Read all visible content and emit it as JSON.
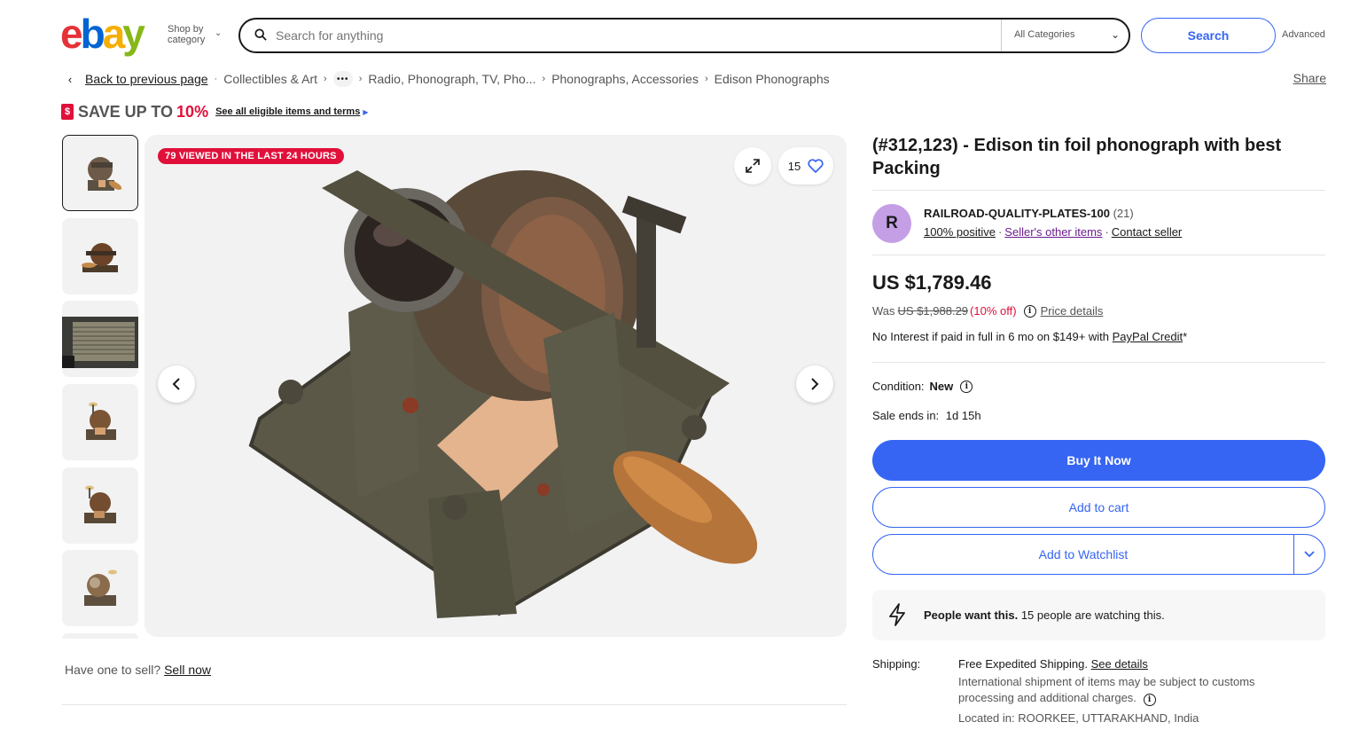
{
  "header": {
    "logo_letters": [
      "e",
      "b",
      "a",
      "y"
    ],
    "shop_by_line1": "Shop by",
    "shop_by_line2": "category",
    "search_placeholder": "Search for anything",
    "category_select": "All Categories",
    "search_button": "Search",
    "advanced_link": "Advanced"
  },
  "breadcrumb": {
    "back": "Back to previous page",
    "items": [
      "Collectibles & Art",
      "Radio, Phonograph, TV, Pho...",
      "Phonographs, Accessories",
      "Edison Phonographs"
    ],
    "more": "•••",
    "share": "Share"
  },
  "promo": {
    "tag_icon": "$",
    "save_text": "SAVE UP TO",
    "save_pct": "10%",
    "see_all": "See all eligible items and terms"
  },
  "gallery": {
    "viewed_badge": "79 VIEWED IN THE LAST 24 HOURS",
    "watch_count": "15",
    "thumbnail_count": 6
  },
  "sell": {
    "text": "Have one to sell?",
    "link": "Sell now"
  },
  "listing": {
    "title": "(#312,123) - Edison tin foil phonograph with best Packing",
    "seller": {
      "avatar_letter": "R",
      "name": "RAILROAD-QUALITY-PLATES-100",
      "feedback_count": "(21)",
      "positive": "100% positive",
      "other_items": "Seller's other items",
      "contact": "Contact seller"
    },
    "price": "US $1,789.46",
    "was_label": "Was",
    "was_price": "US $1,988.29",
    "discount": "(10% off)",
    "price_details": "Price details",
    "financing_text": "No Interest if paid in full in 6 mo on $149+ with",
    "financing_link": "PayPal Credit",
    "financing_suffix": "*",
    "condition_label": "Condition:",
    "condition_value": "New",
    "sale_ends_label": "Sale ends in:",
    "sale_ends_value": "1d 15h",
    "buy_now": "Buy It Now",
    "add_to_cart": "Add to cart",
    "add_to_watchlist": "Add to Watchlist",
    "people_want": "People want this.",
    "people_watching": "15 people are watching this.",
    "shipping_label": "Shipping:",
    "shipping_free": "Free Expedited Shipping.",
    "shipping_details": "See details",
    "shipping_note": "International shipment of items may be subject to customs processing and additional charges.",
    "located": "Located in: ROORKEE, UTTARAKHAND, India"
  },
  "colors": {
    "accent": "#3665f3",
    "promo_red": "#e0103a",
    "avatar": "#c59fe6"
  }
}
